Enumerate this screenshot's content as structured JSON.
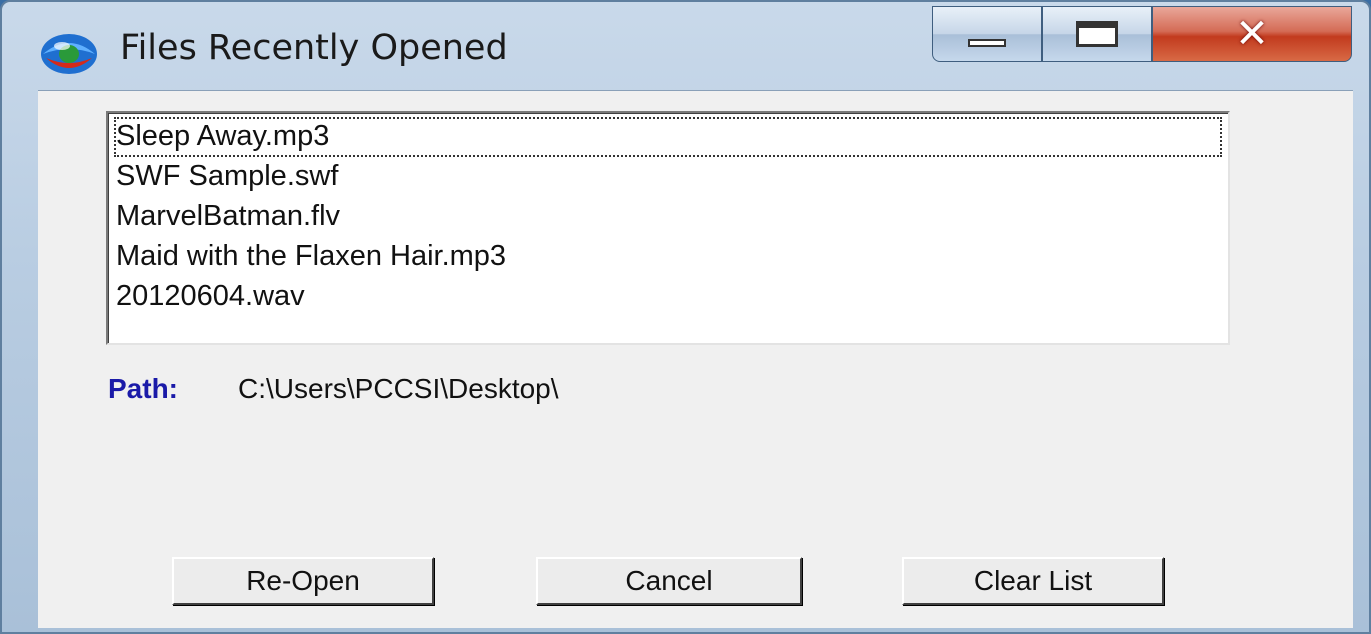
{
  "window": {
    "title": "Files Recently Opened",
    "icon": "globe-app-icon",
    "caption_buttons": {
      "minimize": "minimize-icon",
      "maximize": "maximize-icon",
      "close": "✕"
    }
  },
  "recent_files": {
    "items": [
      {
        "label": "Sleep Away.mp3",
        "focused": true
      },
      {
        "label": "SWF Sample.swf",
        "focused": false
      },
      {
        "label": "MarvelBatman.flv",
        "focused": false
      },
      {
        "label": "Maid with the Flaxen Hair.mp3",
        "focused": false
      },
      {
        "label": "20120604.wav",
        "focused": false
      }
    ]
  },
  "path": {
    "label": "Path:",
    "value": "C:\\Users\\PCCSI\\Desktop\\"
  },
  "buttons": {
    "reopen": "Re-Open",
    "cancel": "Cancel",
    "clear": "Clear List"
  },
  "colors": {
    "path_label": "#1a1aa8",
    "close_button": "#c23a1e"
  }
}
